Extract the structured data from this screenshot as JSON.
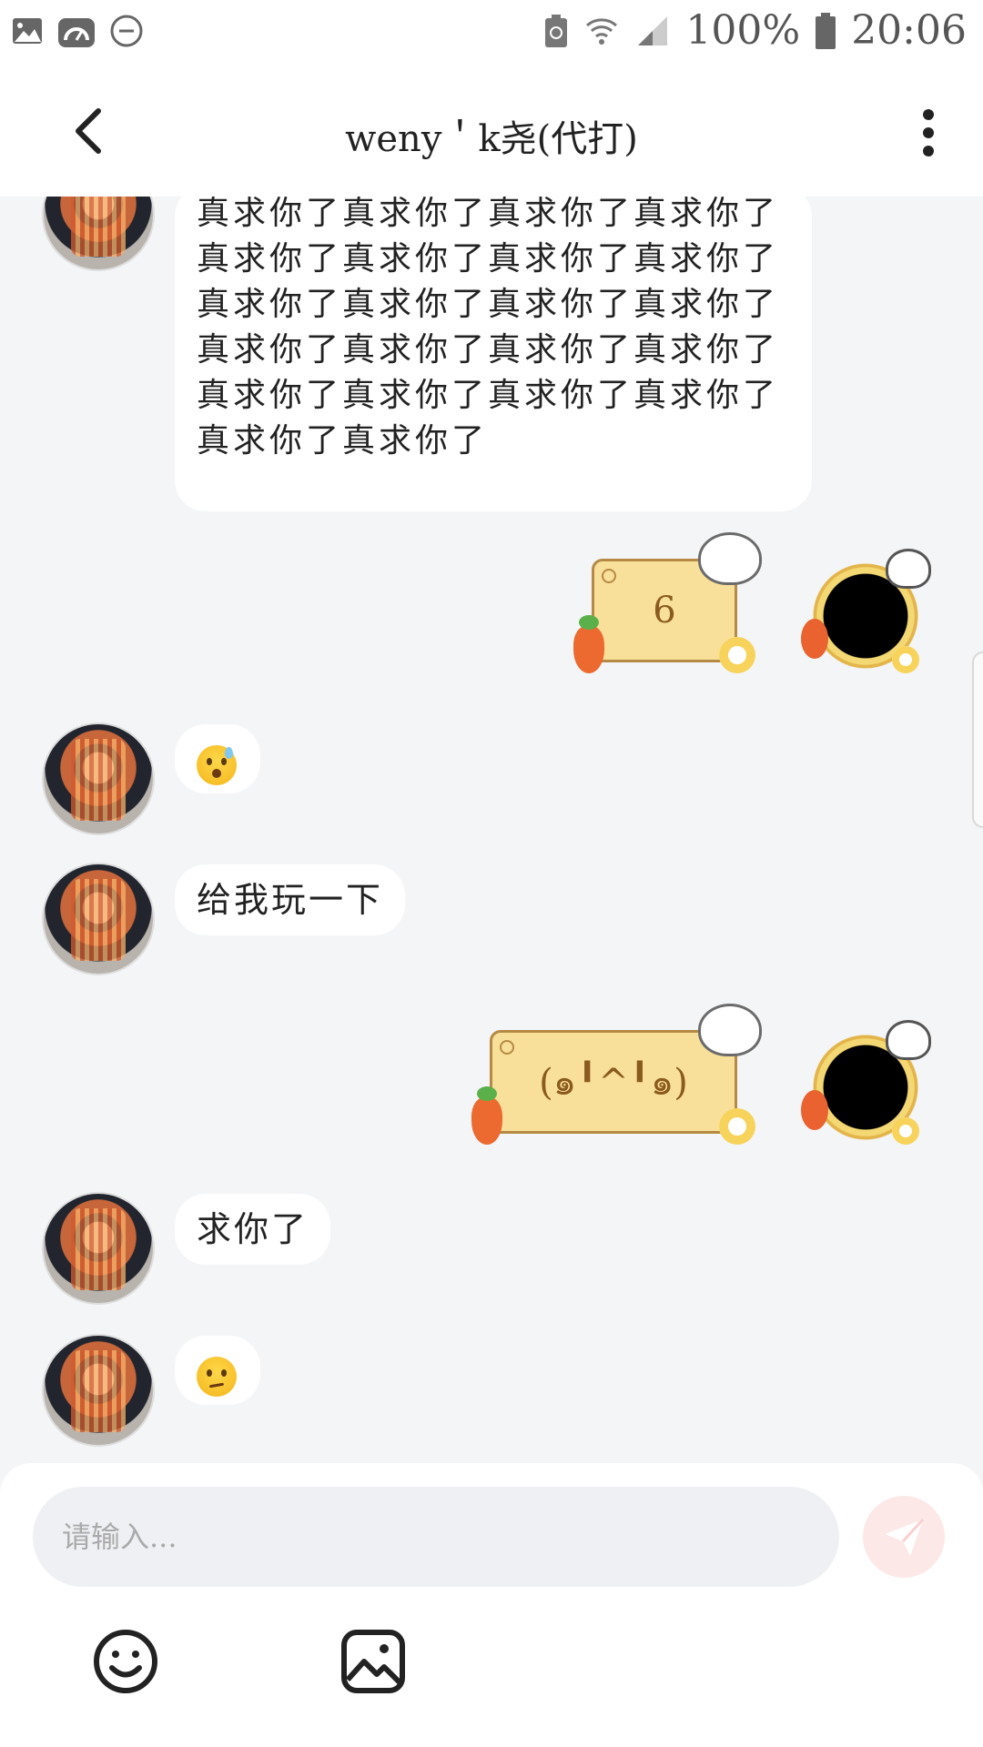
{
  "status_bar": {
    "battery_percent": "100%",
    "time": "20:06",
    "left_icons": [
      "gallery-icon",
      "speed-icon",
      "do-not-disturb-icon"
    ],
    "right_icons": [
      "battery-saver-icon",
      "wifi-icon",
      "signal-icon",
      "battery-icon"
    ]
  },
  "header": {
    "title": "weny＇k尧(代打)",
    "back_icon": "chevron-left-icon",
    "more_icon": "more-vertical-icon"
  },
  "messages": [
    {
      "sender": "other",
      "type": "text",
      "text": "真求你了真求你了真求你了真求你了真求你了真求你了真求你了真求你了真求你了真求你了真求你了真求你了真求你了真求你了真求你了真求你了真求你了真求你了真求你了真求你了真求你了真求你了"
    },
    {
      "sender": "self",
      "type": "sticker",
      "text": "6"
    },
    {
      "sender": "other",
      "type": "emoji",
      "emoji": "hushed-sweat-emoji"
    },
    {
      "sender": "other",
      "type": "text",
      "text": "给我玩一下"
    },
    {
      "sender": "self",
      "type": "sticker",
      "text": "(๑╹^╹๑)"
    },
    {
      "sender": "other",
      "type": "text",
      "text": "求你了"
    },
    {
      "sender": "other",
      "type": "emoji",
      "emoji": "confused-emoji"
    }
  ],
  "composer": {
    "placeholder": "请输入...",
    "value": "",
    "send_icon": "send-icon",
    "tools": [
      "emoji-icon",
      "image-icon"
    ]
  },
  "colors": {
    "background": "#f4f5f7",
    "bubble": "#ffffff",
    "sticker_fill": "#f8e09a",
    "send_button": "#fde8e8"
  }
}
